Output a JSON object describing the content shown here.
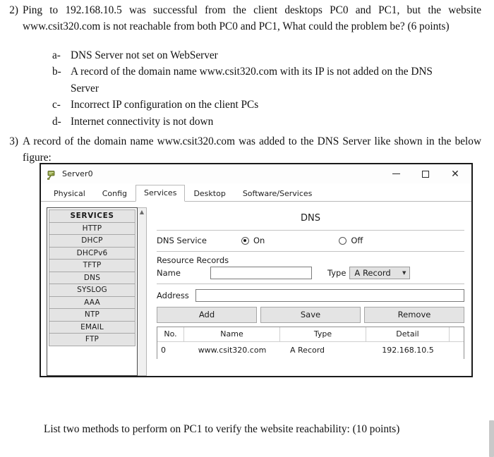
{
  "document": {
    "question2": {
      "number": "2)",
      "text": "Ping to 192.168.10.5 was successful from the client desktops PC0 and PC1, but the website www.csit320.com is not reachable from both PC0 and PC1, What could the problem be? (6 points)",
      "options": [
        {
          "marker": "a-",
          "text": "DNS Server not set on WebServer"
        },
        {
          "marker": "b-",
          "text": "A record of the domain name www.csit320.com with its IP is not added on the DNS Server"
        },
        {
          "marker": "c-",
          "text": "Incorrect IP configuration on the client PCs"
        },
        {
          "marker": "d-",
          "text": "Internet connectivity is not down"
        }
      ]
    },
    "question3": {
      "number": "3)",
      "text": "A record of the domain name www.csit320.com was added to the DNS Server like shown in the below figure:"
    },
    "footer_text": "List two methods to perform on PC1 to verify the website reachability: (10 points)"
  },
  "packet_tracer": {
    "window_title": "Server0",
    "window_icon": "server-icon",
    "controls": {
      "minimize": "—",
      "maximize": "□",
      "close": "✕"
    },
    "tabs": [
      {
        "label": "Physical",
        "active": false
      },
      {
        "label": "Config",
        "active": false
      },
      {
        "label": "Services",
        "active": true
      },
      {
        "label": "Desktop",
        "active": false
      },
      {
        "label": "Software/Services",
        "active": false
      }
    ],
    "services_list": [
      "SERVICES",
      "HTTP",
      "DHCP",
      "DHCPv6",
      "TFTP",
      "DNS",
      "SYSLOG",
      "AAA",
      "NTP",
      "EMAIL",
      "FTP"
    ],
    "dns_panel": {
      "title": "DNS",
      "service_label": "DNS Service",
      "on_label": "On",
      "off_label": "Off",
      "service_state": "On",
      "resource_records_label": "Resource Records",
      "name_label": "Name",
      "name_value": "",
      "name_placeholder": "",
      "type_label": "Type",
      "type_value": "A Record",
      "address_label": "Address",
      "address_value": "",
      "address_placeholder": "",
      "buttons": {
        "add": "Add",
        "save": "Save",
        "remove": "Remove"
      },
      "table": {
        "headers": [
          "No.",
          "Name",
          "Type",
          "Detail"
        ],
        "rows": [
          {
            "no": "0",
            "name": "www.csit320.com",
            "type": "A Record",
            "detail": "192.168.10.5"
          }
        ]
      }
    }
  }
}
